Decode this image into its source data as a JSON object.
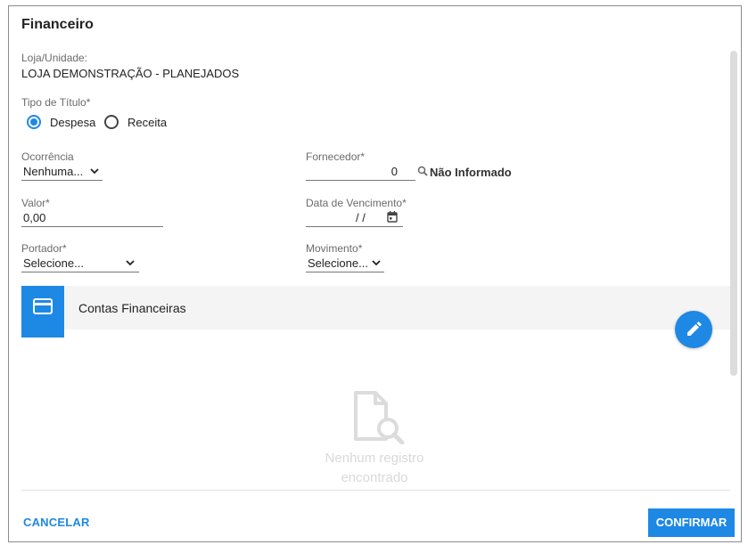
{
  "dialog": {
    "title": "Financeiro",
    "loja_label": "Loja/Unidade:",
    "loja_value": "LOJA DEMONSTRAÇÃO - PLANEJADOS",
    "tipo_label": "Tipo de Título*",
    "tipo_options": [
      {
        "label": "Despesa",
        "selected": true
      },
      {
        "label": "Receita",
        "selected": false
      }
    ],
    "ocorrencia": {
      "label": "Ocorrência",
      "value": "Nenhuma..."
    },
    "fornecedor": {
      "label": "Fornecedor*",
      "code": "0",
      "name": "Não Informado"
    },
    "valor": {
      "label": "Valor*",
      "value": "0,00"
    },
    "vencimento": {
      "label": "Data de Vencimento*",
      "value": "/ /"
    },
    "portador": {
      "label": "Portador*",
      "value": "Selecione..."
    },
    "movimento": {
      "label": "Movimento*",
      "value": "Selecione..."
    },
    "panel": {
      "title": "Contas Financeiras",
      "icon": "credit-card-icon"
    },
    "empty": {
      "line1": "Nenhum registro",
      "line2": "encontrado"
    },
    "buttons": {
      "cancel": "CANCELAR",
      "confirm": "CONFIRMAR"
    }
  },
  "colors": {
    "accent": "#1e88e5",
    "empty_text": "#d9d9d9",
    "border": "#8c8c8c"
  }
}
